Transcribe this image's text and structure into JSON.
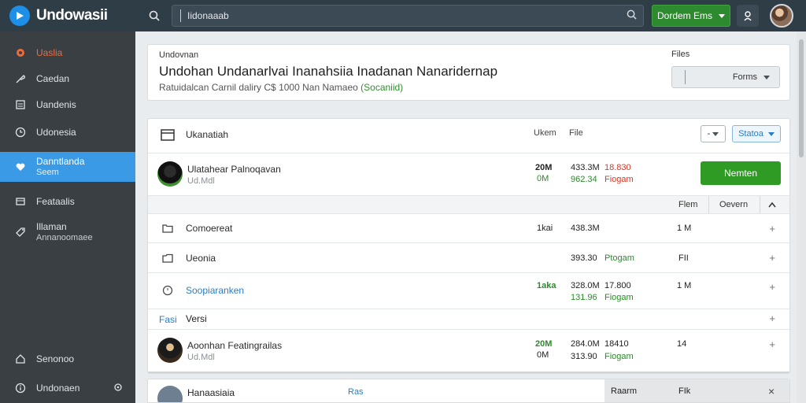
{
  "app": {
    "name": "Undowasii",
    "search_value": "Iidonaaab",
    "top_button": "Dordem Ems"
  },
  "sidebar": {
    "items": [
      {
        "label": "Uaslia",
        "icon": "record-icon"
      },
      {
        "label": "Caedan",
        "icon": "brush-icon"
      },
      {
        "label": "Uandenis",
        "icon": "document-icon"
      },
      {
        "label": "Udonesia",
        "icon": "clock-icon"
      },
      {
        "label": "Danntlanda",
        "sub": "Seem",
        "icon": "heart-icon"
      },
      {
        "label": "Feataalis",
        "icon": "screen-icon"
      },
      {
        "label": "Illaman",
        "sub": "Annanoomaee",
        "icon": "tag-icon"
      },
      {
        "label": "Senonoo",
        "icon": "home-icon"
      },
      {
        "label": "Undonaen",
        "icon": "info-icon"
      }
    ]
  },
  "summary": {
    "eyebrow": "Undovnan",
    "title": "Undohan Undanarlvai Inanahsiia Inadanan Nanaridernap",
    "subtitle_prefix": "Ratuidalcan Carnil daliry C$ 1000 Nan Namaeo",
    "subtitle_link": "(Socaniid)",
    "files_label": "Files",
    "files_select": "Forms"
  },
  "panel": {
    "header": {
      "title": "Ukanatiah",
      "col1": "Ukem",
      "col2": "File",
      "small_btn": "-",
      "status_btn": "Statoa"
    },
    "featured": {
      "name": "Ulatahear Palnoqavan",
      "meta": "Ud.Mdl",
      "v1": "20M",
      "v1b": "0M",
      "v2": "433.3M",
      "v2b": "962.34",
      "v3": "18.830",
      "v3b": "Fiogam",
      "action": "Nemten"
    },
    "subheader": {
      "c1": "Flem",
      "c2": "Oevern"
    },
    "rows": [
      {
        "label": "Comoereat",
        "a": "1kai",
        "b": "438.3M",
        "c": "",
        "d": "1 M",
        "icon": "folder-icon"
      },
      {
        "label": "Ueonia",
        "a": "",
        "b": "393.30",
        "c": "Ptogam",
        "d": "FII",
        "icon": "folder-icon"
      },
      {
        "label": "Soopiaranken",
        "a": "1aka",
        "b": "328.0M",
        "b2": "131.96",
        "c": "17.800",
        "c2": "Fiogam",
        "d": "1 M",
        "icon": "clock-icon"
      }
    ],
    "section": {
      "tag": "Fasi",
      "label": "Versi"
    },
    "featured2": {
      "name": "Aoonhan Featingrailas",
      "meta": "Ud.Mdl",
      "v1": "20M",
      "v1b": "0M",
      "v2": "284.0M",
      "v2b": "313.90",
      "v3": "18410",
      "v3b": "Fiogam",
      "d": "14"
    }
  },
  "bottom": {
    "name": "Hanaasiaia",
    "tag": "Ras",
    "c1": "Raarm",
    "c2": "FIk"
  },
  "colors": {
    "accent": "#3b9ae6",
    "green": "#2f9a24",
    "red": "#d13a2a",
    "topbar": "#2f3d47",
    "sidebar": "#3a3f44"
  }
}
